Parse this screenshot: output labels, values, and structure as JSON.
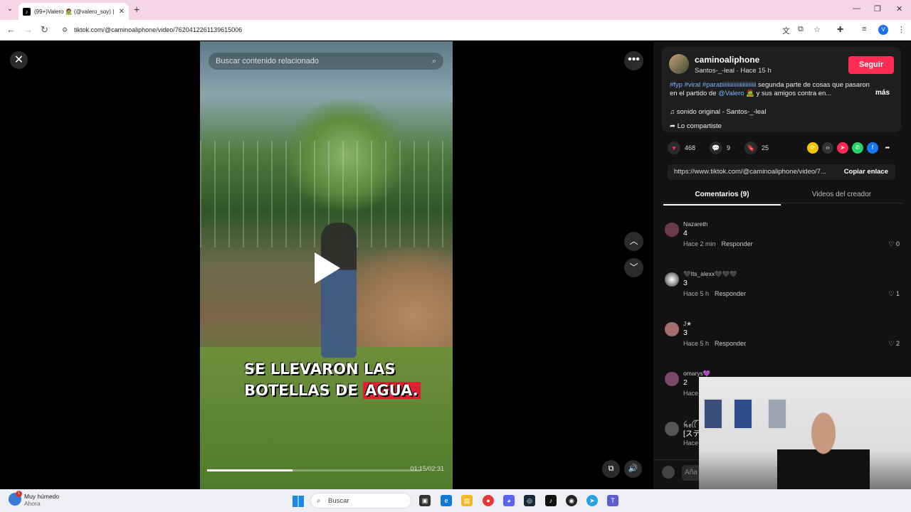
{
  "browser": {
    "tab_title": "(99+)Valero 🧟 (@valero_soy) |",
    "tab_icon": "tiktok-icon",
    "url": "tiktok.com/@caminoaliphone/video/7620412261139615006",
    "profile_letter": "V"
  },
  "video": {
    "search_placeholder": "Buscar contenido relacionado",
    "caption_line1": "SE LLEVARON LAS",
    "caption_line2_a": "BOTELLAS DE ",
    "caption_line2_b": "AGUA.",
    "time": "01:15/02:31",
    "progress": 0.4
  },
  "post": {
    "username": "caminoaliphone",
    "subtitle": "Santos-_-leal · Hace 15 h",
    "follow_label": "Seguir",
    "hashtags": "#fyp #viral #paratiiiiiiiiiiiiiiiiiiiiiii",
    "desc_text": " segunda parte de cosas que pasaron en el partido de ",
    "mention": "@Valero",
    "desc_tail": " 🧟 y sus amigos contra en...",
    "more_label": "más",
    "music": "sonido original - Santos-_-leal",
    "shared": "Lo compartiste",
    "likes": "468",
    "comments": "9",
    "saves": "25",
    "link": "https://www.tiktok.com/@caminoaliphone/video/7...",
    "copy_label": "Copiar enlace",
    "tab_comments": "Comentarios (9)",
    "tab_videos": "Videos del creador"
  },
  "comments": [
    {
      "user": "Nazareth",
      "text": "4",
      "time": "Hace 2 min",
      "reply": "Responder",
      "likes": "0"
    },
    {
      "user": "🖤Its_alexx🖤🖤🖤",
      "text": "3",
      "time": "Hace 5 h",
      "reply": "Responder",
      "likes": "1"
    },
    {
      "user": "J★",
      "text": "3",
      "time": "Hace 5 h",
      "reply": "Responder",
      "likes": "2"
    },
    {
      "user": "omarys💜",
      "text": "2",
      "time": "Hace",
      "reply": "",
      "likes": ""
    },
    {
      "user": "ꫝꫀꪶꪶ",
      "text": "[ステ",
      "time": "Hace",
      "reply": "",
      "likes": ""
    }
  ],
  "comment_input_placeholder": "Aña",
  "taskbar": {
    "weather": "Muy húmedo",
    "weather_sub": "Ahora",
    "weather_badge": "1",
    "search_label": "Buscar"
  }
}
